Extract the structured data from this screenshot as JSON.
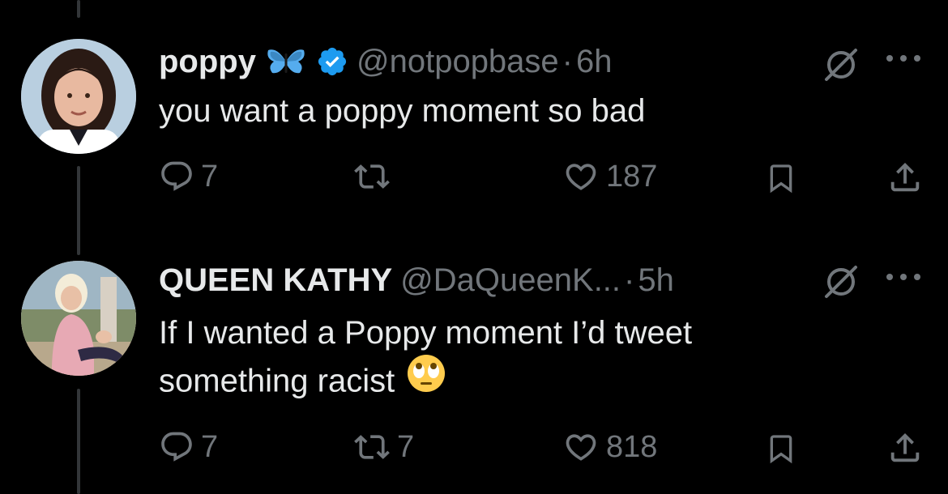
{
  "tweets": [
    {
      "display_name": "poppy",
      "handle": "@notpopbase",
      "separator": "·",
      "time": "6h",
      "text_lines": [
        "you want a poppy moment so bad"
      ],
      "reply_count": "7",
      "retweet_count": "",
      "like_count": "187",
      "badges": [
        "butterfly-emoji",
        "verified-badge-icon"
      ]
    },
    {
      "display_name": "QUEEN KATHY",
      "handle": "@DaQueenK...",
      "separator": "·",
      "time": "5h",
      "text_lines": [
        "If I wanted a Poppy moment I’d tweet",
        "something racist"
      ],
      "reply_count": "7",
      "retweet_count": "7",
      "like_count": "818",
      "emoji": "face-with-rolling-eyes"
    }
  ],
  "colors": {
    "background": "#000000",
    "text_primary": "#e7e9ea",
    "text_secondary": "#71767b",
    "thread_line": "#333639",
    "verified_blue": "#1d9bf0",
    "butterfly_blue": "#55acee"
  }
}
